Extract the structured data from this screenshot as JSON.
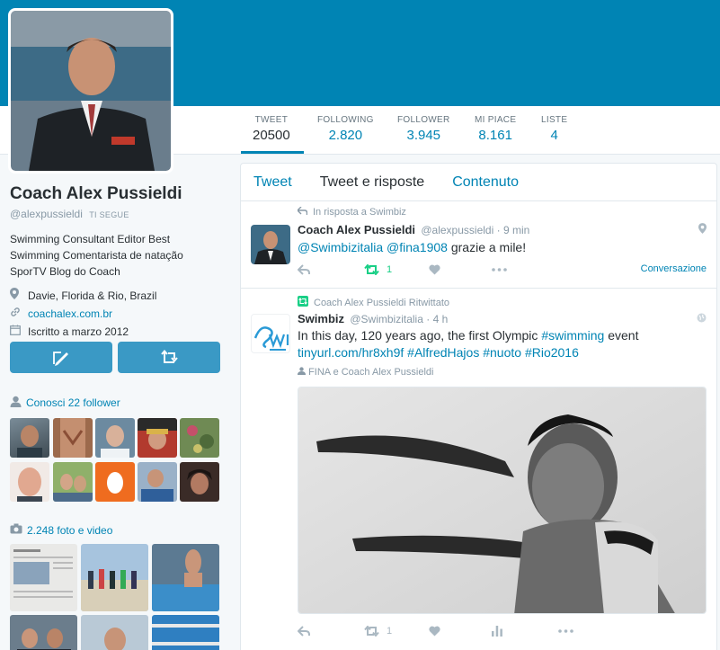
{
  "stats": [
    {
      "label": "TWEET",
      "value": "20500"
    },
    {
      "label": "FOLLOWING",
      "value": "2.820"
    },
    {
      "label": "FOLLOWER",
      "value": "3.945"
    },
    {
      "label": "MI PIACE",
      "value": "8.161"
    },
    {
      "label": "LISTE",
      "value": "4"
    }
  ],
  "profile": {
    "name": "Coach Alex Pussieldi",
    "handle": "@alexpussieldi",
    "follows_you": "TI SEGUE",
    "bio": "Swimming Consultant Editor Best Swimming Comentarista de natação SporTV Blog do Coach",
    "location": "Davie, Florida & Rio, Brazil",
    "website": "coachalex.com.br",
    "joined": "Iscritto a marzo 2012"
  },
  "followers_section": {
    "label": "Conosci 22 follower"
  },
  "media_section": {
    "label": "2.248 foto e video"
  },
  "tabs": [
    "Tweet",
    "Tweet e risposte",
    "Contenuto"
  ],
  "tweets": [
    {
      "context": "In risposta a Swimbiz",
      "author": "Coach Alex Pussieldi",
      "handle": "@alexpussieldi",
      "time": "9 min",
      "mention1": "@Swimbizitalia",
      "mention2": "@fina1908",
      "text": "grazie a mile!",
      "retweets": "1",
      "conversation": "Conversazione"
    },
    {
      "context": "Coach Alex Pussieldi Ritwittato",
      "author": "Swimbiz",
      "handle": "@Swimbizitalia",
      "time": "4 h",
      "text_start": "In this day, 120 years ago, the first Olympic",
      "hashtag1": "#swimming",
      "text_end": "event",
      "link": "tinyurl.com/hr8xh9f",
      "hashtag2": "#AlfredHajos",
      "hashtag3": "#nuoto",
      "hashtag4": "#Rio2016",
      "mentioned": "FINA e Coach Alex Pussieldi",
      "retweets": "1"
    }
  ],
  "colors": {
    "banner": "#0084b4",
    "link": "#0084b4",
    "retweet": "#19cf86",
    "button": "#3a99c5"
  }
}
